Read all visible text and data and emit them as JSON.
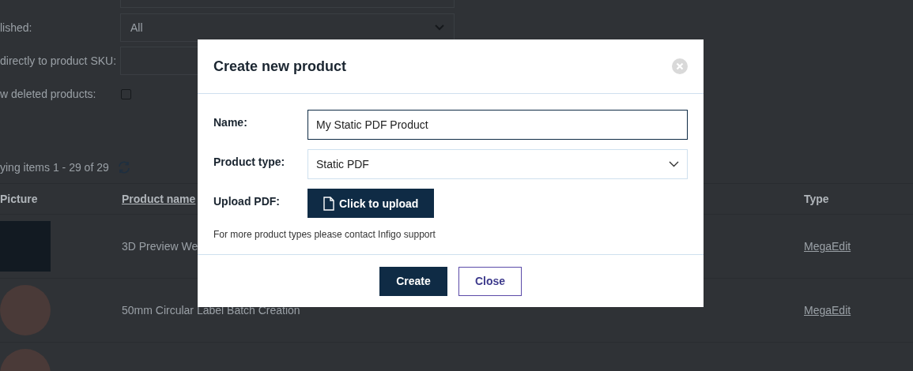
{
  "filters": [
    {
      "kind": "input"
    },
    {
      "kind": "select",
      "label": "lished:",
      "value": "All"
    },
    {
      "kind": "input",
      "label": "directly to product SKU:"
    },
    {
      "kind": "checkbox",
      "label": "w deleted products:",
      "checked": false
    }
  ],
  "paging": "ying items 1 - 29 of 29",
  "table": {
    "columns": [
      "Picture",
      "Product name",
      "Type"
    ],
    "rows": [
      {
        "kind": "square",
        "name": "3D Preview We",
        "type": "MegaEdit"
      },
      {
        "kind": "round",
        "name": "50mm Circular Label Batch Creation",
        "type": "MegaEdit"
      },
      {
        "kind": "round"
      }
    ]
  },
  "dialog": {
    "title": "Create new product",
    "fields": [
      {
        "kind": "input",
        "label": "Name:",
        "value": "My Static PDF Product"
      },
      {
        "kind": "select",
        "label": "Product type:",
        "value": "Static PDF"
      },
      {
        "kind": "upload",
        "label": "Upload PDF:",
        "value": "Click to upload"
      }
    ],
    "note": "For more product types please contact Infigo support",
    "buttons": [
      {
        "label": "Create",
        "kind": "primary"
      },
      {
        "label": "Close",
        "kind": "secondary"
      }
    ]
  }
}
